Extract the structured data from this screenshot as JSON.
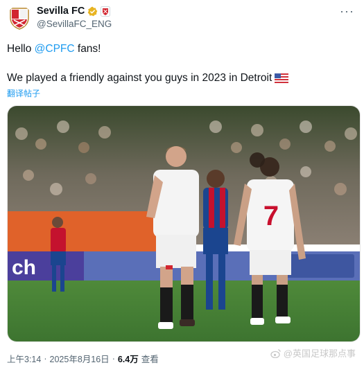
{
  "account": {
    "display_name": "Sevilla FC",
    "handle": "@SevillaFC_ENG",
    "more_label": "···"
  },
  "post": {
    "line1_prefix": "Hello ",
    "mention": "@CPFC",
    "line1_suffix": " fans!",
    "line2": "We played a friendly against you guys in 2023 in Detroit",
    "translate_label": "翻译帖子"
  },
  "photo": {
    "ad_text": "ch",
    "player_front_number": "7"
  },
  "meta": {
    "time": "上午3:14",
    "separator1": "·",
    "date": "2025年8月16日",
    "separator2": "·",
    "views": "6.4万",
    "views_label": "查看"
  },
  "watermark": {
    "text": "@英国足球那点事"
  },
  "colors": {
    "accent": "#1d9bf0",
    "sevilla_red": "#d22630",
    "palace_blue": "#1b458f",
    "palace_red": "#c4122e"
  }
}
